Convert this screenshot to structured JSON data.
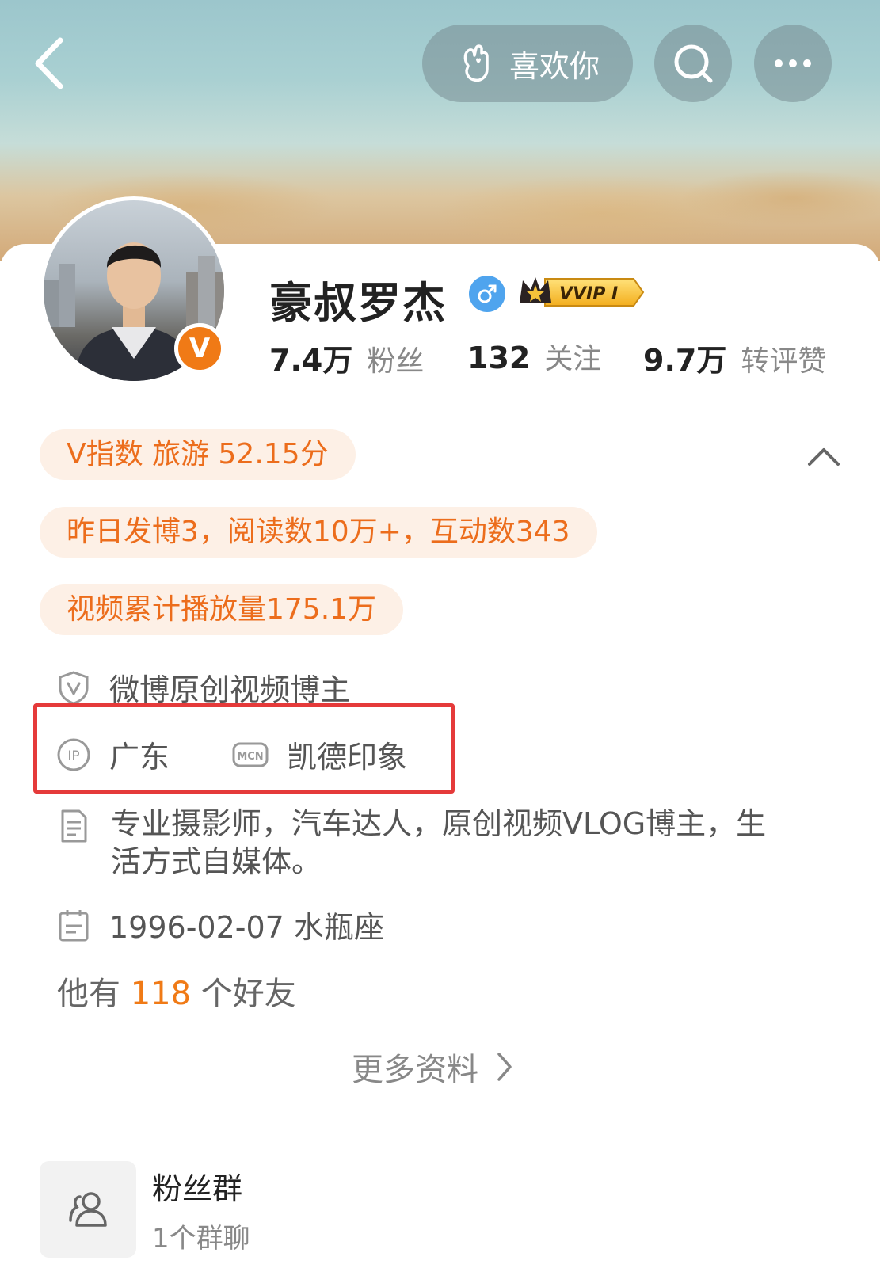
{
  "header": {
    "like_label": "喜欢你"
  },
  "profile": {
    "name": "豪叔罗杰",
    "vip_label": "VVIP I",
    "avatar_badge": "V",
    "stats": [
      {
        "value": "7.4万",
        "label": "粉丝"
      },
      {
        "value": "132",
        "label": "关注"
      },
      {
        "value": "9.7万",
        "label": "转评赞"
      }
    ]
  },
  "tags": {
    "v_index": "V指数 旅游 52.15分",
    "yesterday": "昨日发博3，阅读数10万+，互动数343",
    "video_total": "视频累计播放量175.1万"
  },
  "info": {
    "certification": "微博原创视频博主",
    "ip_label": "IP",
    "ip_location": "广东",
    "mcn_label": "MCN",
    "mcn_name": "凯德印象",
    "bio": "专业摄影师，汽车达人，原创视频VLOG博主，生活方式自媒体。",
    "birthday": "1996-02-07 水瓶座",
    "friends_prefix": "他有",
    "friends_count": "118",
    "friends_suffix": "个好友"
  },
  "more_label": "更多资料",
  "fan_group": {
    "title": "粉丝群",
    "subtitle": "1个群聊"
  },
  "colors": {
    "accent": "#f07a16",
    "pill_bg": "#fdf0e6",
    "highlight_border": "#e53a3a",
    "gender_blue": "#4fa4ee"
  }
}
